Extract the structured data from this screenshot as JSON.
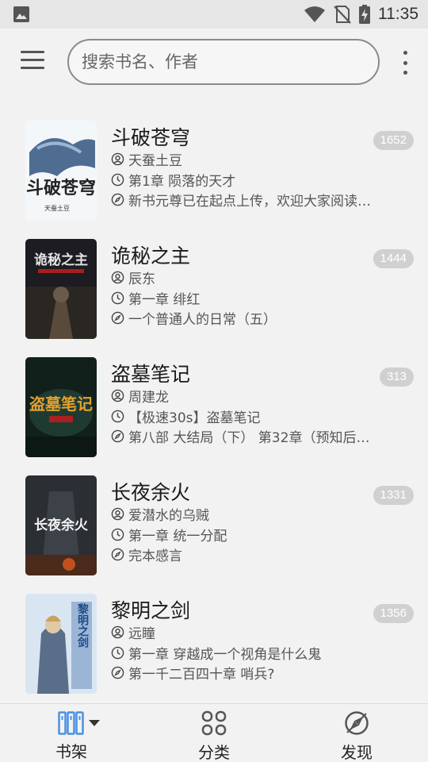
{
  "status_bar": {
    "time": "11:35"
  },
  "search": {
    "placeholder": "搜索书名、作者"
  },
  "books": [
    {
      "title": "斗破苍穹",
      "author": "天蚕土豆",
      "chapter": "第1章 陨落的天才",
      "latest": "新书元尊已在起点上传，欢迎大家阅读…",
      "count": "1652",
      "cover_text": "斗破苍穹",
      "cover_sub": "天蚕土豆"
    },
    {
      "title": "诡秘之主",
      "author": "辰东",
      "chapter": "第一章 绯红",
      "latest": "一个普通人的日常（五）",
      "count": "1444",
      "cover_text": "诡秘之主"
    },
    {
      "title": "盗墓笔记",
      "author": "周建龙",
      "chapter": "【极速30s】盗墓笔记",
      "latest": "第八部 大结局（下） 第32章（预知后事…",
      "count": "313",
      "cover_text": "盗墓笔记"
    },
    {
      "title": "长夜余火",
      "author": "爱潜水的乌贼",
      "chapter": "第一章 统一分配",
      "latest": "完本感言",
      "count": "1331",
      "cover_text": "长夜余火"
    },
    {
      "title": "黎明之剑",
      "author": "远瞳",
      "chapter": "第一章 穿越成一个视角是什么鬼",
      "latest": "第一千二百四十章 哨兵?",
      "count": "1356",
      "cover_text": "黎明之剑"
    }
  ],
  "bottom_nav": {
    "bookshelf": "书架",
    "category": "分类",
    "discover": "发现"
  },
  "colors": {
    "accent": "#4a90e2",
    "badge": "#d0d0d0"
  }
}
